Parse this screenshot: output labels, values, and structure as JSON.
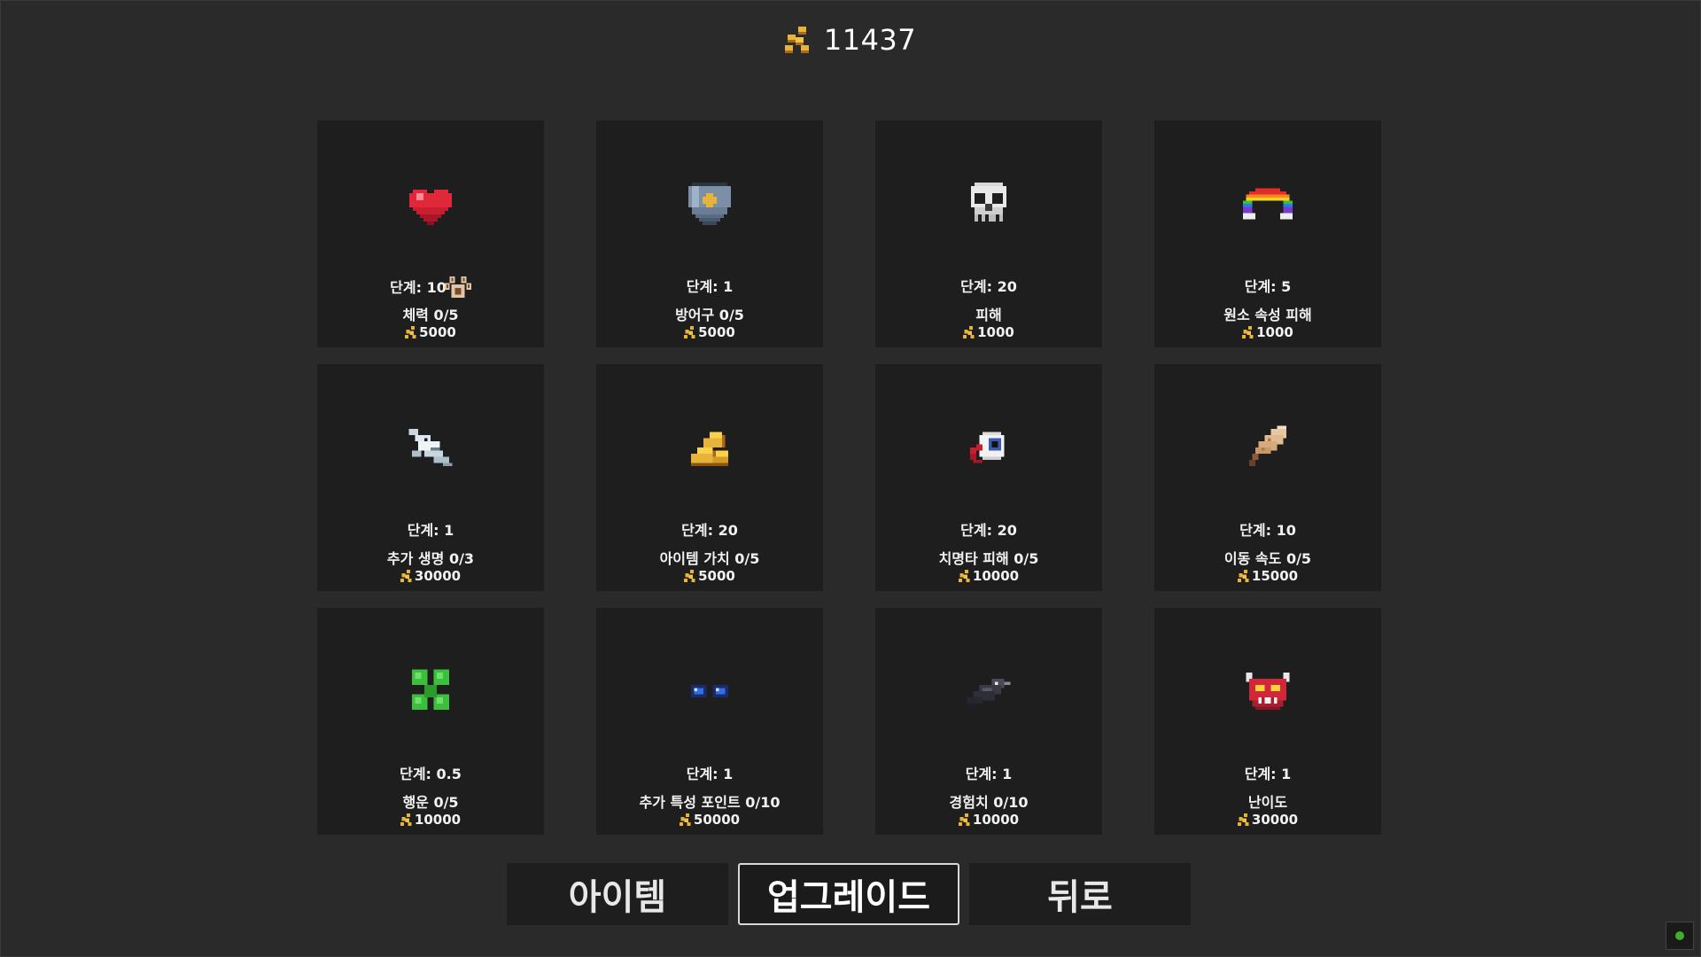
{
  "currency": {
    "amount": "11437",
    "icon": "gold-coins-icon",
    "color": "#e8b33a"
  },
  "upgrades": [
    {
      "icon": "heart-icon",
      "level": "단계: 10",
      "name": "체력 0/5",
      "cost": "5000",
      "extra_icon": "paw-icon"
    },
    {
      "icon": "shield-icon",
      "level": "단계: 1",
      "name": "방어구 0/5",
      "cost": "5000"
    },
    {
      "icon": "skull-icon",
      "level": "단계: 20",
      "name": "피해",
      "cost": "1000"
    },
    {
      "icon": "rainbow-icon",
      "level": "단계: 5",
      "name": "원소 속성 피해",
      "cost": "1000"
    },
    {
      "icon": "fish-icon",
      "level": "단계: 1",
      "name": "추가 생명 0/3",
      "cost": "30000"
    },
    {
      "icon": "gold-bars-icon",
      "level": "단계: 20",
      "name": "아이템 가치 0/5",
      "cost": "5000"
    },
    {
      "icon": "eyeball-icon",
      "level": "단계: 20",
      "name": "치명타 피해 0/5",
      "cost": "10000"
    },
    {
      "icon": "feather-icon",
      "level": "단계: 10",
      "name": "이동 속도 0/5",
      "cost": "15000"
    },
    {
      "icon": "clover-icon",
      "level": "단계: 0.5",
      "name": "행운 0/5",
      "cost": "10000"
    },
    {
      "icon": "glowing-eyes-icon",
      "level": "단계: 1",
      "name": "추가 특성 포인트 0/10",
      "cost": "50000"
    },
    {
      "icon": "crow-icon",
      "level": "단계: 1",
      "name": "경험치 0/10",
      "cost": "10000"
    },
    {
      "icon": "demon-icon",
      "level": "단계: 1",
      "name": "난이도",
      "cost": "30000"
    }
  ],
  "tabs": [
    {
      "label": "아이템",
      "active": false
    },
    {
      "label": "업그레이드",
      "active": true
    },
    {
      "label": "뒤로",
      "active": false
    }
  ],
  "status": {
    "color": "#3fae2a"
  }
}
